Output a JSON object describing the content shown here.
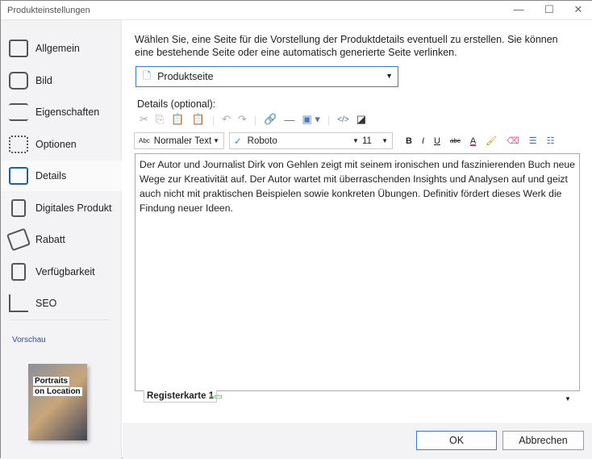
{
  "window": {
    "title": "Produkteinstellungen",
    "minimize": "—",
    "maximize": "☐",
    "close": "✕"
  },
  "sidebar": {
    "items": [
      {
        "label": "Allgemein",
        "icon": "layout-icon"
      },
      {
        "label": "Bild",
        "icon": "camera-icon"
      },
      {
        "label": "Eigenschaften",
        "icon": "list-icon"
      },
      {
        "label": "Optionen",
        "icon": "grid-icon"
      },
      {
        "label": "Details",
        "icon": "details-icon",
        "selected": true
      },
      {
        "label": "Digitales Produkt",
        "icon": "download-file-icon"
      },
      {
        "label": "Rabatt",
        "icon": "tag-icon"
      },
      {
        "label": "Verfügbarkeit",
        "icon": "clipboard-check-icon"
      },
      {
        "label": "SEO",
        "icon": "chart-icon"
      }
    ],
    "preview_label": "Vorschau",
    "book": {
      "line1": "Portraits",
      "line2": "on Location"
    }
  },
  "main": {
    "intro": "Wählen Sie, eine Seite für die Vorstellung der Produktdetails eventuell zu erstellen. Sie können eine bestehende Seite oder eine automatisch generierte Seite verlinken.",
    "page_select": "Produktseite",
    "details_label": "Details (optional):",
    "style_select": "Normaler Text",
    "style_prefix": "Abc",
    "font_select": "Roboto",
    "font_size": "11",
    "fmt": {
      "bold": "B",
      "italic": "I",
      "underline": "U",
      "strike": "abc",
      "color": "A"
    },
    "content": "Der Autor und Journalist Dirk von Gehlen zeigt mit seinem ironischen und  faszinierenden Buch neue Wege zur Kreativität auf. Der Autor wartet mit  überraschenden Insights und Analysen auf und geizt auch nicht mit praktischen Beispielen sowie konkreten Übungen. Definitiv fördert dieses  Werk die Findung neuer Ideen.",
    "tab": "Registerkarte 1"
  },
  "footer": {
    "ok": "OK",
    "cancel": "Abbrechen"
  }
}
